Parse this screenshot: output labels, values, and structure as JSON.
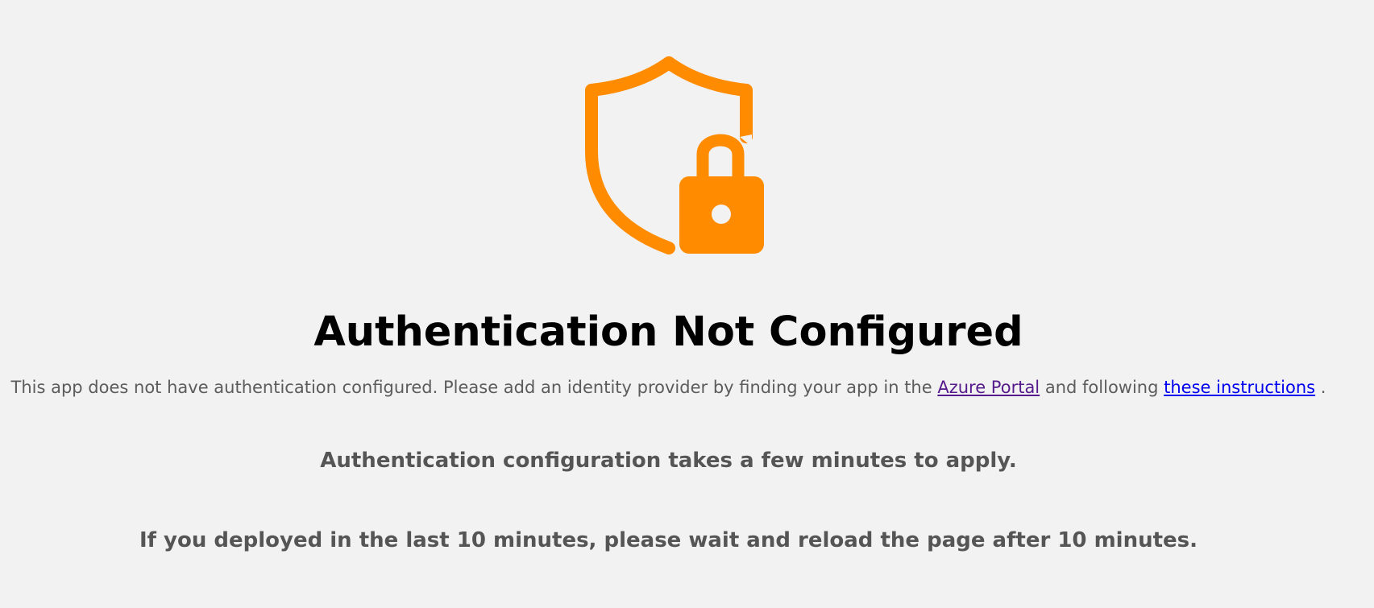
{
  "icon": {
    "name": "shield-lock-icon",
    "color": "#ff8c00"
  },
  "title": "Authentication Not Configured",
  "description": {
    "before_link1": "This app does not have authentication configured. Please add an identity provider by finding your app in the",
    "link1_label": "Azure Portal",
    "between_links": "and following",
    "link2_label": "these instructions",
    "after_link2": "."
  },
  "notes": {
    "line1": "Authentication configuration takes a few minutes to apply.",
    "line2": "If you deployed in the last 10 minutes, please wait and reload the page after 10 minutes."
  },
  "colors": {
    "background": "#f2f2f2",
    "title": "#000000",
    "body_text": "#5c5c5c",
    "link_visited": "#551a8b",
    "link": "#0000ee"
  }
}
